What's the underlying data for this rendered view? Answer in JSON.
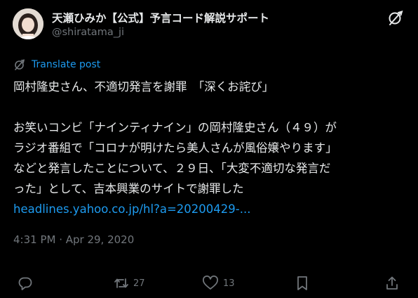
{
  "header": {
    "display_name": "天瀬ひみか【公式】予言コード解説サポート",
    "handle": "@shiratama_ji",
    "avatar_icon": "profile-avatar",
    "menu_icon": "grok-icon"
  },
  "translate": {
    "icon": "translate-icon",
    "label": "Translate post"
  },
  "post": {
    "text": "岡村隆史さん、不適切発言を謝罪　「深くお詫び」\n\nお笑いコンビ「ナインティナイン」の岡村隆史さん（４９）が\nラジオ番組で「コロナが明けたら美人さんが風俗嬢やります」\nなどと発言したことについて、２９日、「大変不適切な発言だ\nった」として、吉本興業のサイトで謝罪した",
    "link": "headlines.yahoo.co.jp/hl?a=20200429-..."
  },
  "meta": {
    "timestamp": "4:31 PM · Apr 29, 2020"
  },
  "actions": {
    "reply_icon": "reply-icon",
    "repost_icon": "repost-icon",
    "repost_count": "27",
    "like_icon": "heart-icon",
    "like_count": "13",
    "bookmark_icon": "bookmark-icon",
    "share_icon": "share-icon"
  },
  "colors": {
    "background": "#000000",
    "text": "#e7e9ea",
    "secondary": "#71767b",
    "link": "#1d9bf0"
  }
}
